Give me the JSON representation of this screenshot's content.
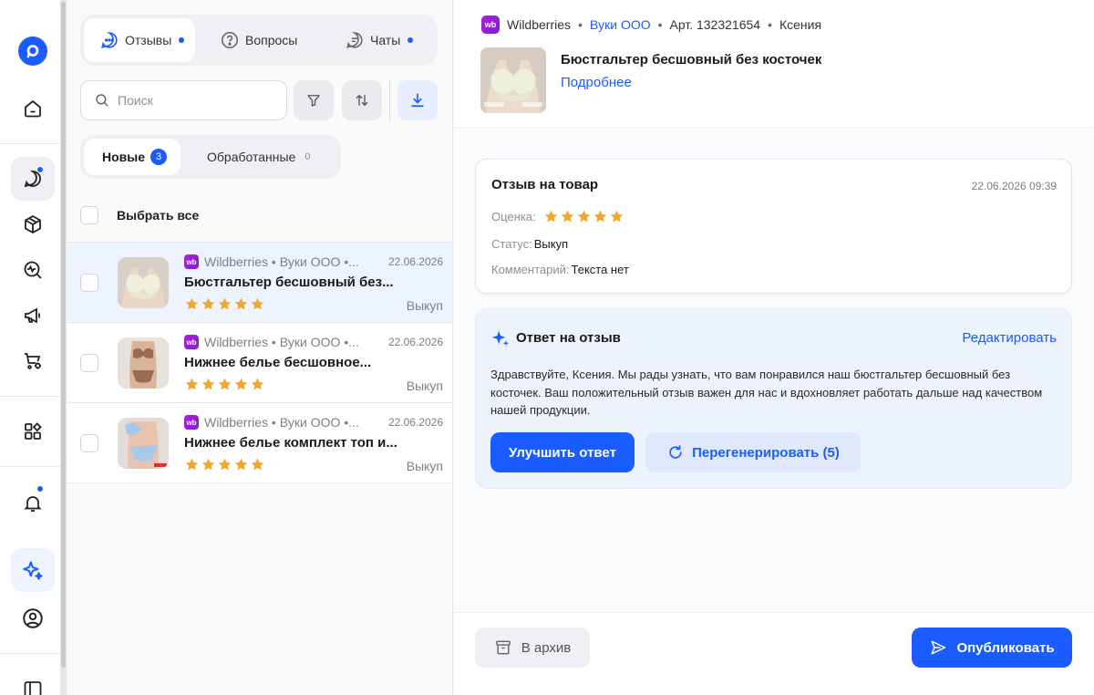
{
  "colors": {
    "accent": "#1a5cff",
    "star": "#f5a623",
    "wb": "#a21fd6"
  },
  "sidebar": {
    "logo": "logo-icon",
    "items": [
      {
        "name": "home",
        "icon": "home-icon"
      },
      {
        "name": "reviews",
        "icon": "chat-bubble-icon",
        "active": true,
        "dot": true
      },
      {
        "name": "products",
        "icon": "box-icon"
      },
      {
        "name": "analytics",
        "icon": "pulse-icon"
      },
      {
        "name": "promotion",
        "icon": "megaphone-icon"
      },
      {
        "name": "cart-settings",
        "icon": "cart-gear-icon"
      },
      {
        "name": "apps",
        "icon": "widgets-icon"
      },
      {
        "name": "notifications",
        "icon": "bell-icon",
        "dot": true
      },
      {
        "name": "ai",
        "icon": "sparkle-icon",
        "active": true
      },
      {
        "name": "profile",
        "icon": "user-circle-icon"
      },
      {
        "name": "panel",
        "icon": "sidebar-panel-icon"
      }
    ]
  },
  "tabs": {
    "reviews": "Отзывы",
    "questions": "Вопросы",
    "chats": "Чаты"
  },
  "search": {
    "placeholder": "Поиск"
  },
  "segments": {
    "new_label": "Новые",
    "new_count": "3",
    "done_label": "Обработанные",
    "done_count": "0"
  },
  "select_all": "Выбрать все",
  "reviews": [
    {
      "marketplace": "Wildberries",
      "meta": "Wildberries • Вуки ООО •...",
      "date": "22.06.2026",
      "title": "Бюстгальтер бесшовный без...",
      "rating": 5,
      "status": "Выкуп"
    },
    {
      "marketplace": "Wildberries",
      "meta": "Wildberries • Вуки ООО •...",
      "date": "22.06.2026",
      "title": "Нижнее белье бесшовное...",
      "rating": 5,
      "status": "Выкуп"
    },
    {
      "marketplace": "Wildberries",
      "meta": "Wildberries • Вуки ООО •...",
      "date": "22.06.2026",
      "title": "Нижнее белье комплект топ и...",
      "rating": 5,
      "status": "Выкуп"
    }
  ],
  "detail": {
    "wb_badge": "wb",
    "marketplace": "Wildberries",
    "seller": "Вуки ООО",
    "article": "Арт. 132321654",
    "customer": "Ксения",
    "product_title": "Бюстгальтер бесшовный без косточек",
    "more_link": "Подробнее",
    "review": {
      "title": "Отзыв на товар",
      "date": "22.06.2026 09:39",
      "rating_label": "Оценка:",
      "rating": 5,
      "status_label": "Статус:",
      "status_value": "Выкуп",
      "comment_label": "Комментарий:",
      "comment_value": "Текста нет"
    },
    "reply": {
      "title": "Ответ на отзыв",
      "edit": "Редактировать",
      "text": "Здравствуйте, Ксения. Мы рады узнать, что вам понравился наш бюстгальтер бесшовный без косточек. Ваш положительный отзыв важен для нас и вдохновляет работать дальше над качеством нашей продукции.",
      "improve": "Улучшить ответ",
      "regenerate": "Перегенерировать (5)"
    },
    "footer": {
      "archive": "В архив",
      "publish": "Опубликовать"
    }
  }
}
